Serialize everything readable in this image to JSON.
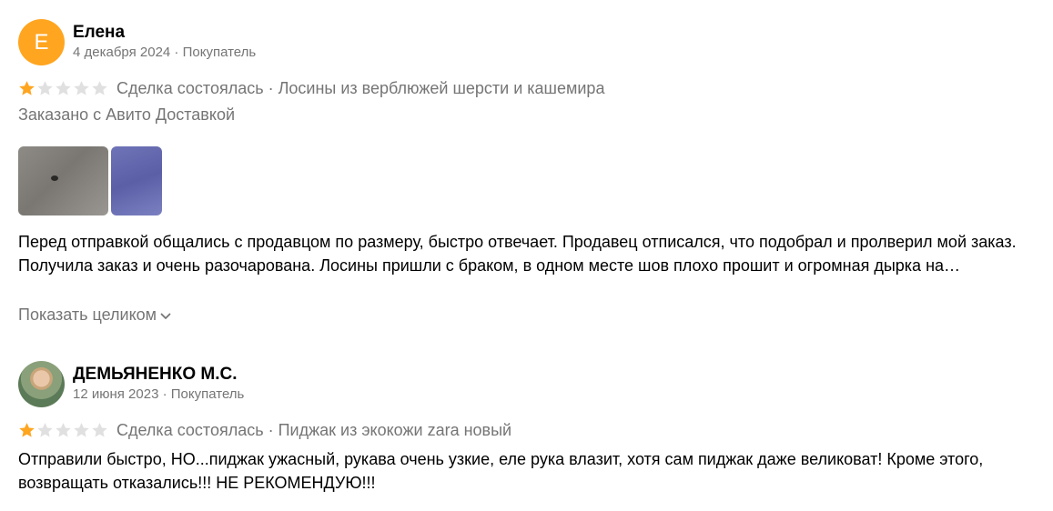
{
  "reviews": [
    {
      "avatar_letter": "Е",
      "name": "Елена",
      "meta": "4 декабря 2024 · Покупатель",
      "rating": 1,
      "rating_max": 5,
      "deal": "Сделка состоялась · Лосины из верблюжей шерсти и кашемира",
      "delivery": "Заказано с Авито Доставкой",
      "photos": [
        "photo-grey-fabric-hole",
        "photo-blue-fabric-seam"
      ],
      "text_line1": "Перед отправкой общались с продавцом по размеру, быстро отвечает. Продавец отписался, что подобрал и пролверил мой заказ.",
      "text_line2": "Получила заказ и очень разочарована. Лосины пришли с браком, в одном месте шов плохо прошит и огромная дырка на…",
      "show_more": "Показать целиком"
    },
    {
      "name": "ДЕМЬЯНЕНКО М.С.",
      "meta": "12 июня 2023 · Покупатель",
      "rating": 1,
      "rating_max": 5,
      "deal": "Сделка состоялась · Пиджак из экокожи zara новый",
      "text": "Отправили быстро, НО...пиджак ужасный, рукава очень узкие, еле рука влазит, хотя сам пиджак даже великоват! Кроме этого, возвращать отказались!!! НЕ РЕКОМЕНДУЮ!!!"
    }
  ],
  "colors": {
    "star_filled": "#ffa51f",
    "star_empty": "#e0e0e0",
    "avatar_bg": "#ffa51f",
    "muted_text": "#757575"
  }
}
